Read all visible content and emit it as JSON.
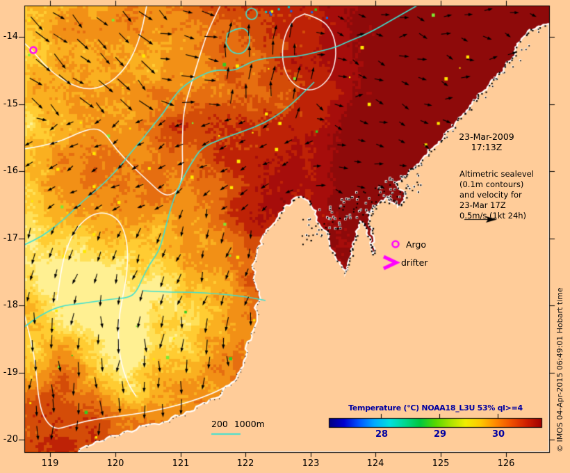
{
  "title_block": {
    "date": "23-Mar-2009",
    "time": "17:13Z"
  },
  "altimetric_note": {
    "lines": [
      "Altimetric sealevel",
      "(0.1m contours)",
      "and velocity for",
      "23-Mar 17Z",
      "0.5m/s (1kt 24h)"
    ]
  },
  "markers": {
    "argo_label": "Argo",
    "drifter_label": "drifter",
    "color": "#FF00FF"
  },
  "scale_legend": {
    "label": "200 1000m",
    "line_color": "#3FE0D0"
  },
  "axes": {
    "lon_labels": [
      "119",
      "120",
      "121",
      "122",
      "123",
      "124",
      "125",
      "126"
    ],
    "lat_labels": [
      "-14",
      "-15",
      "-16",
      "-17",
      "-18",
      "-19",
      "-20"
    ]
  },
  "colorbar": {
    "title": "Temperature (°C) NOAA18_L3U 53% ql>=4",
    "tick_labels": [
      "28",
      "29",
      "30"
    ],
    "tick_values": [
      28,
      29,
      30
    ],
    "range": [
      27.1,
      30.75
    ],
    "text_color": "#0000A0",
    "gradient": [
      "#000080",
      "#0000D0",
      "#0055FF",
      "#00AAFF",
      "#00E0E0",
      "#00D890",
      "#00C840",
      "#55D800",
      "#AAE300",
      "#F0EE00",
      "#FFC800",
      "#FF8800",
      "#F05000",
      "#D02000",
      "#A00000"
    ]
  },
  "map": {
    "land_color": "#FFCC99",
    "coast_outline": "#FFFFFF",
    "ocean_palette": [
      "#8E0A0A",
      "#A60D0B",
      "#BE2206",
      "#D44C08",
      "#E66E10",
      "#F29016",
      "#FAB020",
      "#FFCC32",
      "#FFE058",
      "#FFF092"
    ],
    "speck_green": "#33CC22",
    "speck_green2": "#7FE833",
    "speck_yellow": "#FFE800",
    "speck_blue": "#1166EE",
    "speck_cyan": "#00CCCC",
    "sealevel_contour_color": "#FFFFFF",
    "bathymetry_contour_color": "#3FE0D0",
    "velocity_arrow_color": "#000000"
  },
  "copyright": "© IMOS 04-Apr-2015 06:49:01 Hobart time"
}
